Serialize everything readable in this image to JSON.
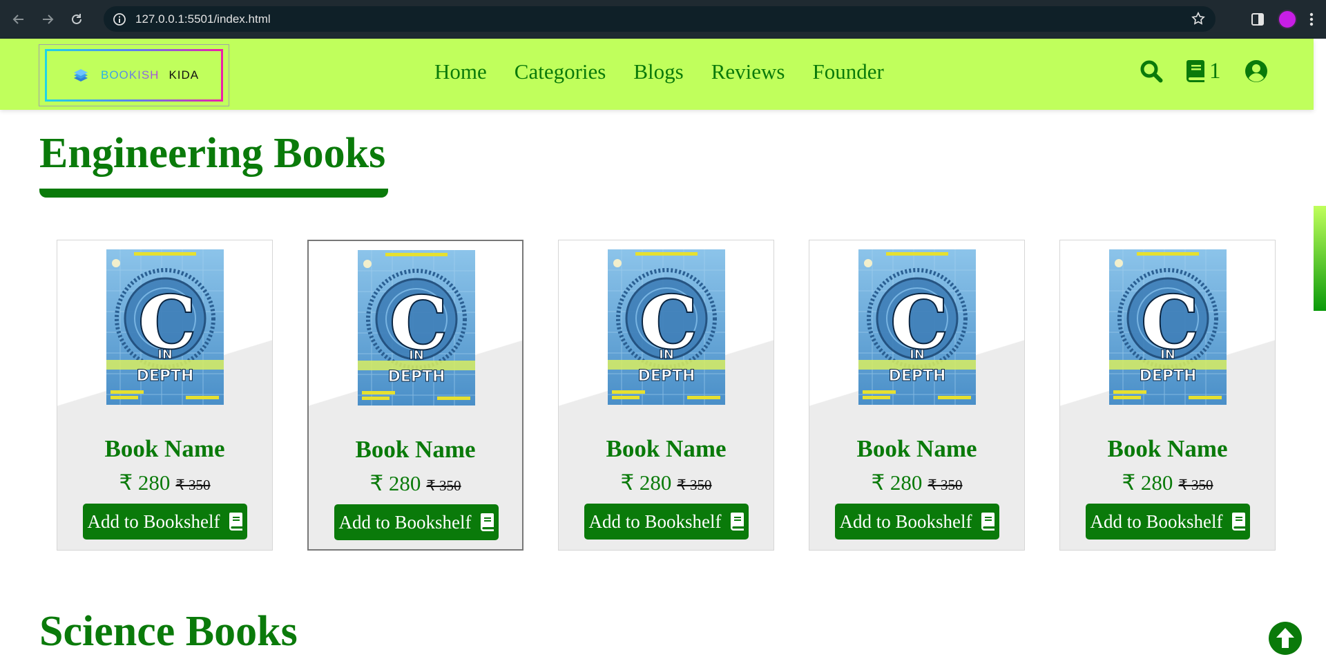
{
  "browser": {
    "url": "127.0.0.1:5501/index.html",
    "profile_color": "#c81ee6"
  },
  "header": {
    "logo": {
      "word1": "BOOKISH",
      "word2": "KIDA"
    },
    "nav": [
      "Home",
      "Categories",
      "Blogs",
      "Reviews",
      "Founder"
    ],
    "bookshelf_count": "1",
    "icons": [
      "search-icon",
      "bookshelf-icon",
      "user-icon"
    ]
  },
  "colors": {
    "brand_green": "#0a7a0a",
    "header_bg": "#c0ff5c"
  },
  "sections": [
    {
      "title": "Engineering Books",
      "books": [
        {
          "cover_title": "C",
          "cover_sub1": "IN",
          "cover_sub2": "DEPTH",
          "name": "Book Name",
          "price": "₹ 280",
          "old_price": "₹ 350",
          "button": "Add to Bookshelf"
        },
        {
          "cover_title": "C",
          "cover_sub1": "IN",
          "cover_sub2": "DEPTH",
          "name": "Book Name",
          "price": "₹ 280",
          "old_price": "₹ 350",
          "button": "Add to Bookshelf"
        },
        {
          "cover_title": "C",
          "cover_sub1": "IN",
          "cover_sub2": "DEPTH",
          "name": "Book Name",
          "price": "₹ 280",
          "old_price": "₹ 350",
          "button": "Add to Bookshelf"
        },
        {
          "cover_title": "C",
          "cover_sub1": "IN",
          "cover_sub2": "DEPTH",
          "name": "Book Name",
          "price": "₹ 280",
          "old_price": "₹ 350",
          "button": "Add to Bookshelf"
        },
        {
          "cover_title": "C",
          "cover_sub1": "IN",
          "cover_sub2": "DEPTH",
          "name": "Book Name",
          "price": "₹ 280",
          "old_price": "₹ 350",
          "button": "Add to Bookshelf"
        }
      ]
    },
    {
      "title": "Science Books"
    }
  ]
}
